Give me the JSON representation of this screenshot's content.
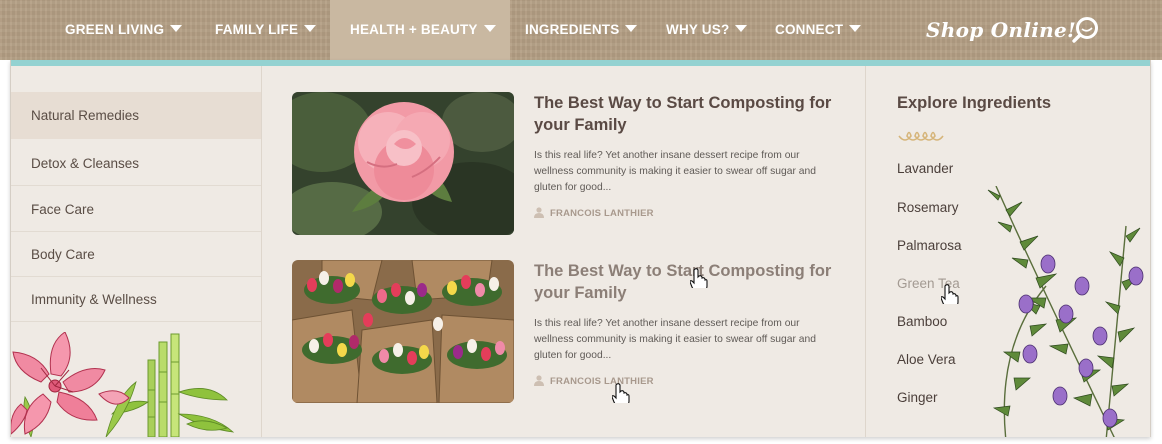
{
  "nav": {
    "items": [
      {
        "label": "GREEN LIVING",
        "active": false
      },
      {
        "label": "FAMILY LIFE",
        "active": false
      },
      {
        "label": "HEALTH + BEAUTY",
        "active": true
      },
      {
        "label": "INGREDIENTS",
        "active": false
      },
      {
        "label": "WHY US?",
        "active": false
      },
      {
        "label": "CONNECT",
        "active": false
      }
    ],
    "shop_label": "Shop Online!",
    "search_icon": "search-icon"
  },
  "colors": {
    "nav_bg": "#b49f84",
    "nav_active_bg": "#c9b8a1",
    "accent_bar": "#94d2d1",
    "menu_bg": "#efeae4",
    "category_active_bg": "#e7ddd3",
    "heading_text": "#5a4a44",
    "author_text": "#a8998d"
  },
  "categories": [
    {
      "label": "Natural Remedies",
      "active": true
    },
    {
      "label": "Detox & Cleanses",
      "active": false
    },
    {
      "label": "Face Care",
      "active": false
    },
    {
      "label": "Body Care",
      "active": false
    },
    {
      "label": "Immunity & Wellness",
      "active": false
    }
  ],
  "articles": [
    {
      "image": "pink-rose-photo",
      "title": "The Best Way to Start Composting for your Family",
      "excerpt": "Is this real life? Yet another insane dessert recipe from our wellness community is making it easier to swear off sugar and gluten for good...",
      "author": "FRANCOIS LANTHIER"
    },
    {
      "image": "tulip-bouquets-photo",
      "title": "The Best Way to Start Composting for your Family",
      "excerpt": "Is this real life? Yet another insane dessert recipe from our wellness community is making it easier to swear off sugar and gluten for good...",
      "author": "FRANCOIS LANTHIER"
    }
  ],
  "explore": {
    "title": "Explore Ingredients",
    "items": [
      "Lavander",
      "Rosemary",
      "Palmarosa",
      "Green Tea",
      "Bamboo",
      "Aloe Vera",
      "Ginger"
    ],
    "hovered": "Green Tea"
  }
}
